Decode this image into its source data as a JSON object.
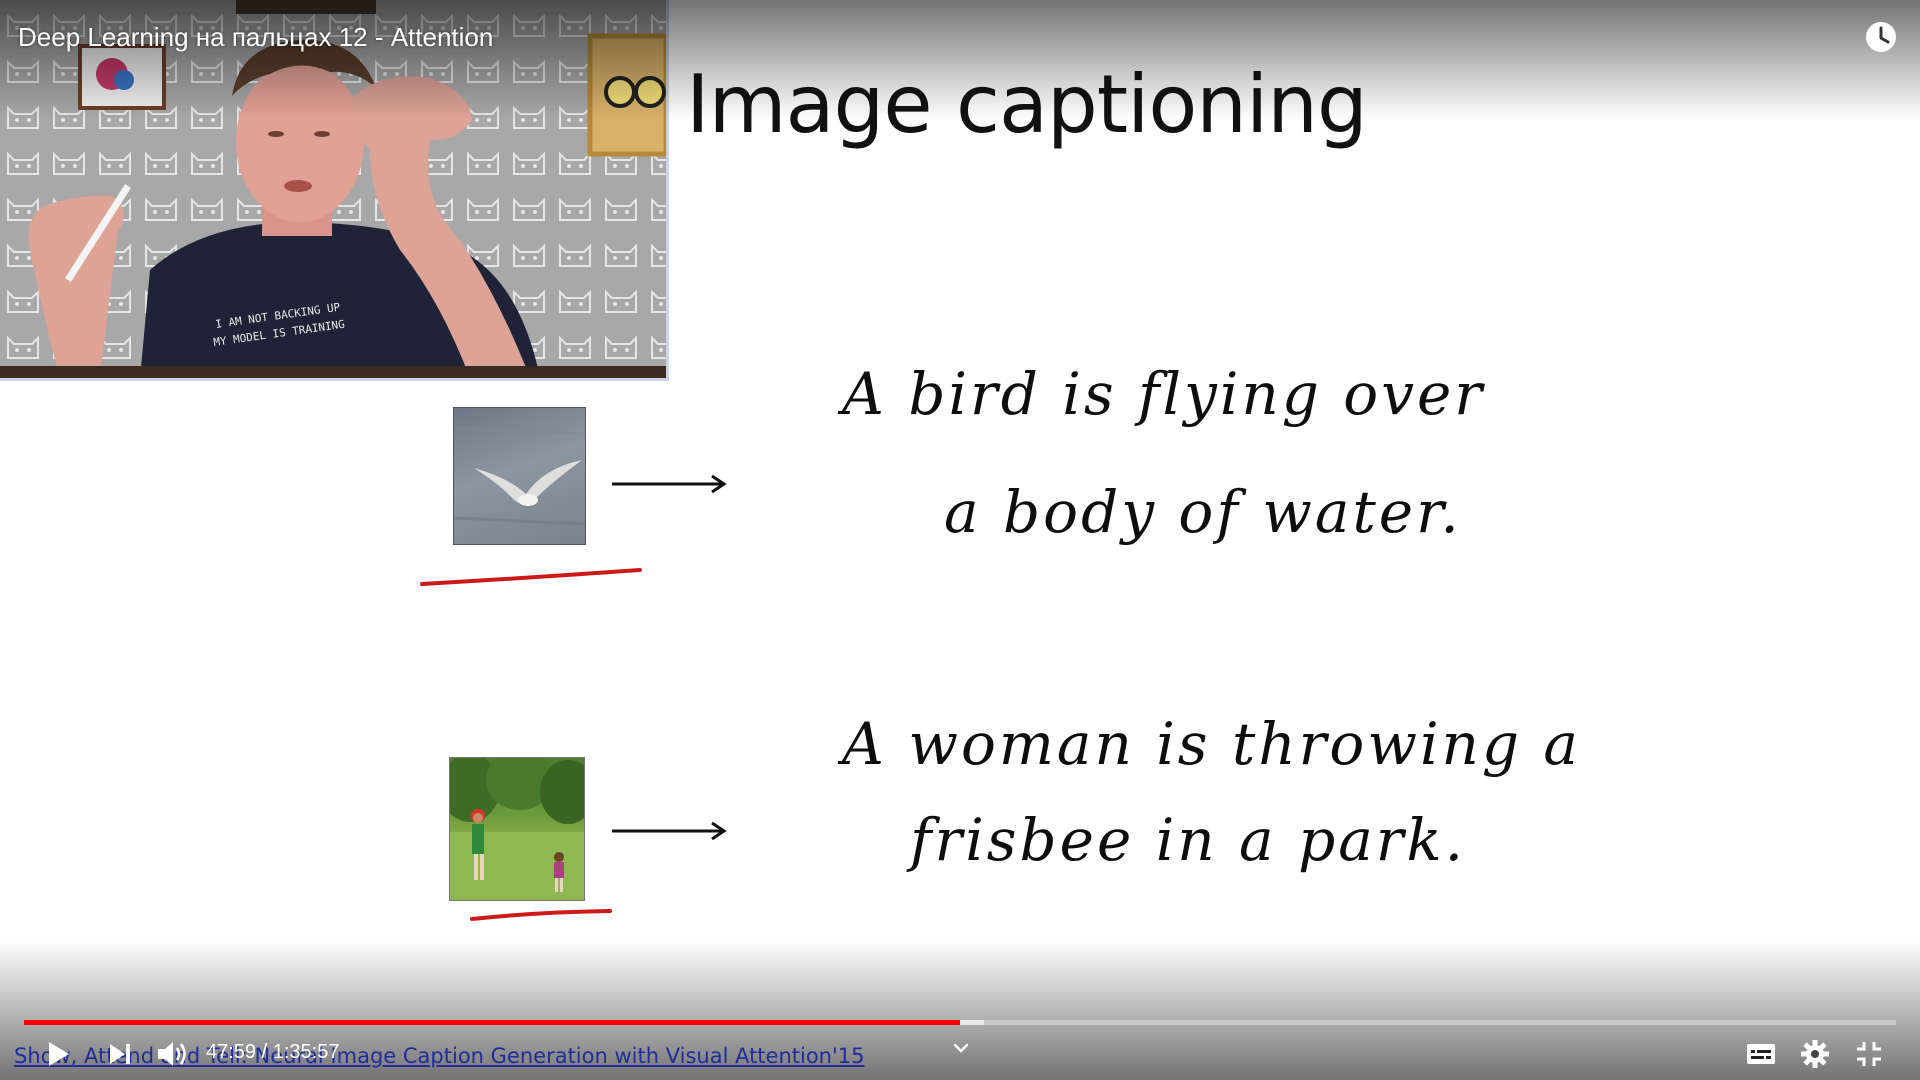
{
  "video": {
    "title": "Deep Learning на пальцах 12 - Attention"
  },
  "slide": {
    "title": "Image captioning",
    "caption_1_line_1": "A bird is flying over",
    "caption_1_line_2": "a body of water.",
    "caption_2_line_1": "A woman is throwing a",
    "caption_2_line_2": "frisbee in a park.",
    "citation": "Show, Attend and Tell: Neural Image Caption Generation with Visual Attention'15"
  },
  "controls": {
    "current_time": "47:59",
    "time_separator": " / ",
    "duration": "1:35:57",
    "progress_fraction": 0.5,
    "buffered_fraction": 0.513,
    "icons": {
      "play": "play-icon",
      "next": "next-icon",
      "volume": "volume-icon",
      "captions": "captions-icon",
      "settings": "gear-icon",
      "exit_fullscreen": "exit-fullscreen-icon",
      "watch_later": "clock-icon",
      "chapters": "chevron-down-icon"
    }
  },
  "colors": {
    "progress_played": "#ff0000",
    "citation_link": "#1d2d9c",
    "underline_marker": "#cc1a1a"
  }
}
